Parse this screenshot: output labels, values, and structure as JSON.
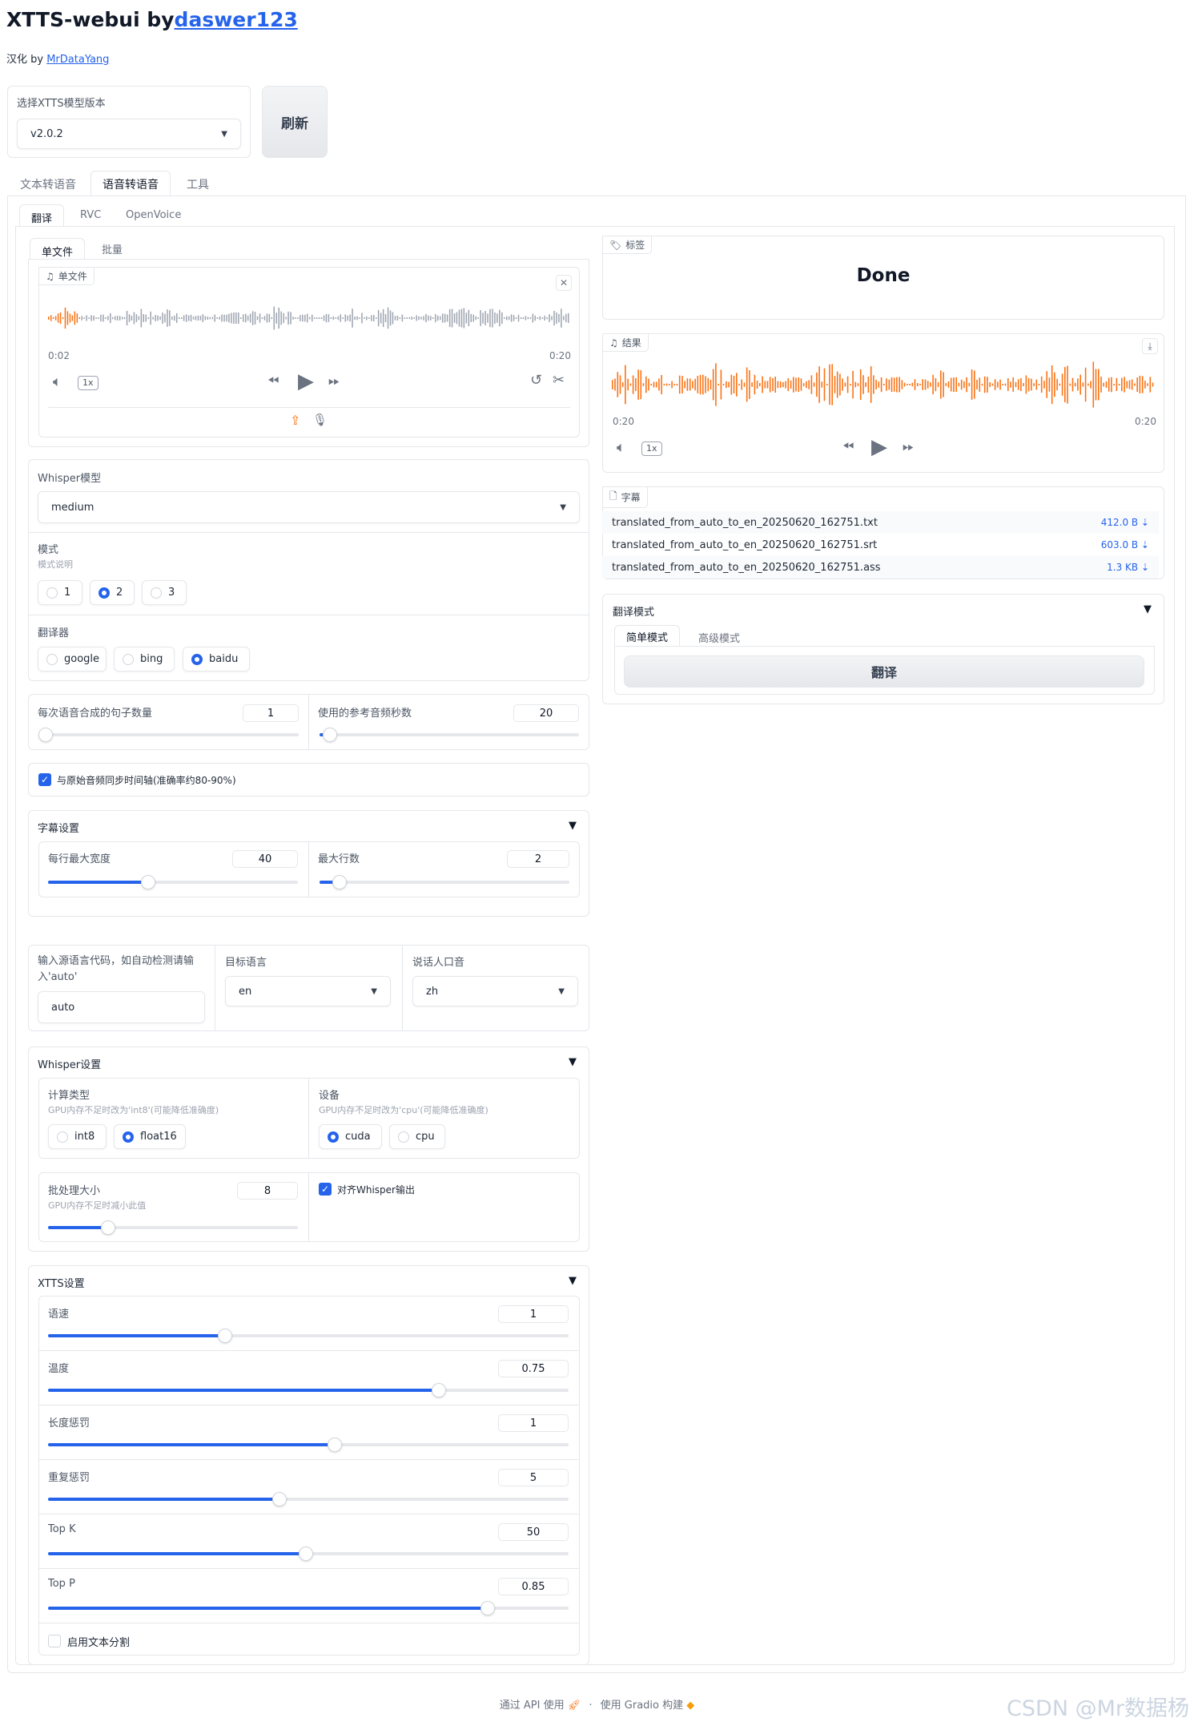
{
  "header": {
    "title_prefix": "XTTS-webui by",
    "title_link": "daswer123",
    "subtitle_prefix": "汉化 by ",
    "subtitle_link": "MrDataYang"
  },
  "model": {
    "label": "选择XTTS模型版本",
    "value": "v2.0.2",
    "refresh_label": "刷新"
  },
  "main_tabs": [
    "文本转语音",
    "语音转语音",
    "工具"
  ],
  "sub_tabs": [
    "翻译",
    "RVC",
    "OpenVoice"
  ],
  "file_tabs": [
    "单文件",
    "批量"
  ],
  "input_audio": {
    "label": "单文件",
    "time_current": "0:02",
    "time_total": "0:20",
    "speed": "1x"
  },
  "whisper_model": {
    "label": "Whisper模型",
    "value": "medium"
  },
  "mode": {
    "label": "模式",
    "sub": "模式说明",
    "options": [
      "1",
      "2",
      "3"
    ],
    "selected": "2"
  },
  "translator": {
    "label": "翻译器",
    "options": [
      "google",
      "bing",
      "baidu"
    ],
    "selected": "baidu"
  },
  "sentences": {
    "label": "每次语音合成的句子数量",
    "value": "1",
    "fraction": 0.0
  },
  "ref_seconds": {
    "label": "使用的参考音频秒数",
    "value": "20",
    "fraction": 0.04
  },
  "sync_checkbox": {
    "label": "与原始音频同步时间轴(准确率约80-90%)",
    "checked": true
  },
  "subtitle_settings": {
    "label": "字幕设置",
    "max_width": {
      "label": "每行最大宽度",
      "value": "40",
      "fraction": 0.4
    },
    "max_lines": {
      "label": "最大行数",
      "value": "2",
      "fraction": 0.08
    }
  },
  "lang": {
    "source_label": "输入源语言代码，如自动检测请输入'auto'",
    "source_value": "auto",
    "target_label": "目标语言",
    "target_value": "en",
    "speaker_label": "说话人口音",
    "speaker_value": "zh"
  },
  "whisper_settings": {
    "label": "Whisper设置",
    "compute_label": "计算类型",
    "compute_sub": "GPU内存不足时改为'int8'(可能降低准确度)",
    "compute_options": [
      "int8",
      "float16"
    ],
    "compute_selected": "float16",
    "device_label": "设备",
    "device_sub": "GPU内存不足时改为'cpu'(可能降低准确度)",
    "device_options": [
      "cuda",
      "cpu"
    ],
    "device_selected": "cuda",
    "batch_label": "批处理大小",
    "batch_sub": "GPU内存不足时减小此值",
    "batch_value": "8",
    "batch_fraction": 0.24,
    "align_label": "对齐Whisper输出",
    "align_checked": true
  },
  "xtts_settings": {
    "label": "XTTS设置",
    "sliders": [
      {
        "label": "语速",
        "value": "1",
        "fraction": 0.34
      },
      {
        "label": "温度",
        "value": "0.75",
        "fraction": 0.75
      },
      {
        "label": "长度惩罚",
        "value": "1",
        "fraction": 0.55
      },
      {
        "label": "重复惩罚",
        "value": "5",
        "fraction": 0.445
      },
      {
        "label": "Top K",
        "value": "50",
        "fraction": 0.495
      },
      {
        "label": "Top P",
        "value": "0.85",
        "fraction": 0.845
      }
    ],
    "split_label": "启用文本分割",
    "split_checked": false
  },
  "right": {
    "label_badge": "标签",
    "status": "Done",
    "result_badge": "结果",
    "result_time_current": "0:20",
    "result_time_total": "0:20",
    "result_speed": "1x",
    "subs_badge": "字幕",
    "files": [
      {
        "name": "translated_from_auto_to_en_20250620_162751.txt",
        "size": "412.0 B ⇣"
      },
      {
        "name": "translated_from_auto_to_en_20250620_162751.srt",
        "size": "603.0 B ⇣"
      },
      {
        "name": "translated_from_auto_to_en_20250620_162751.ass",
        "size": "1.3 KB ⇣"
      }
    ],
    "translate_mode_label": "翻译模式",
    "mode_tabs": [
      "简单模式",
      "高级模式"
    ],
    "translate_button": "翻译"
  },
  "footer": {
    "api": "通过 API 使用",
    "built": "使用 Gradio 构建",
    "sep": "·"
  },
  "watermark": "CSDN @Mr数据杨",
  "colors": {
    "accent": "#2563eb",
    "wave_orange": "#f97316",
    "wave_gray": "#9ca3af"
  }
}
